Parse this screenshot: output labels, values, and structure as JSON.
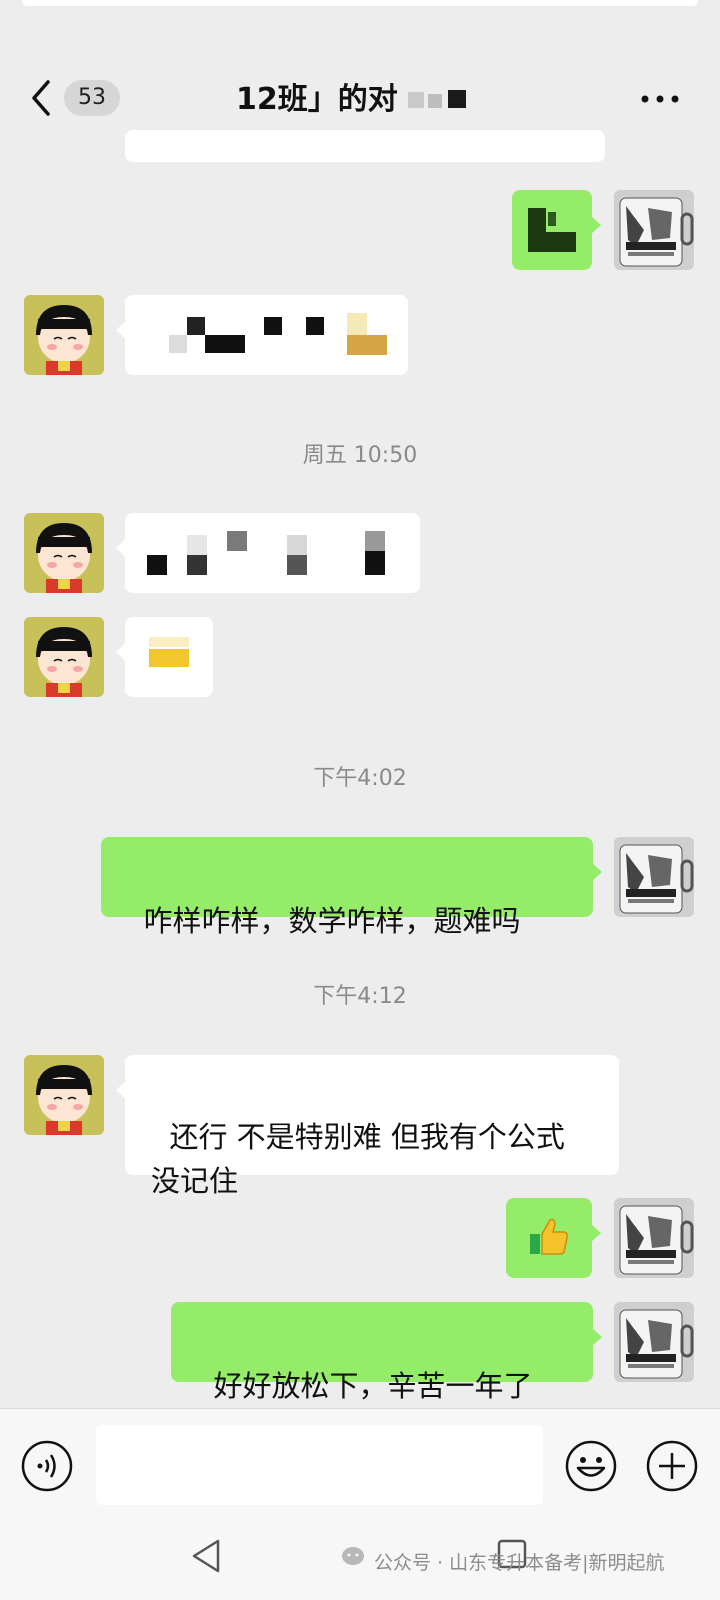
{
  "header": {
    "back_icon": "chevron-left-icon",
    "unread_badge": "53",
    "title": "12班」的对",
    "more_icon": "more-dots-icon"
  },
  "messages": [
    {
      "type": "out-sticker",
      "content": "green pixelated sticker"
    },
    {
      "type": "in-mosaic",
      "content": "pixelated redacted text"
    },
    {
      "type": "timestamp",
      "text": "周五 10:50"
    },
    {
      "type": "in-mosaic",
      "content": "pixelated redacted text"
    },
    {
      "type": "in-mosaic",
      "content": "pixelated yellow emoji"
    },
    {
      "type": "timestamp",
      "text": "下午4:02"
    },
    {
      "type": "out-text",
      "text": "咋样咋样，数学咋样，题难吗"
    },
    {
      "type": "timestamp",
      "text": "下午4:12"
    },
    {
      "type": "in-text",
      "text": "还行 不是特别难 但我有个公式\n没记住"
    },
    {
      "type": "out-emoji",
      "icon": "thumbs-up-icon",
      "text": "👍"
    },
    {
      "type": "out-text",
      "text": "好好放松下，辛苦一年了"
    }
  ],
  "input_bar": {
    "voice_icon": "voice-input-icon",
    "text_value": "",
    "emoji_icon": "emoji-smile-icon",
    "plus_icon": "plus-circle-icon"
  },
  "nav_bar": {
    "back_icon": "triangle-back-icon",
    "watermark": "公众号 · 山东专升本备考|新明起航"
  },
  "colors": {
    "background": "#ededed",
    "bubble_out": "#95ec69",
    "bubble_in": "#ffffff",
    "timestamp_text": "#8a8a8a"
  }
}
